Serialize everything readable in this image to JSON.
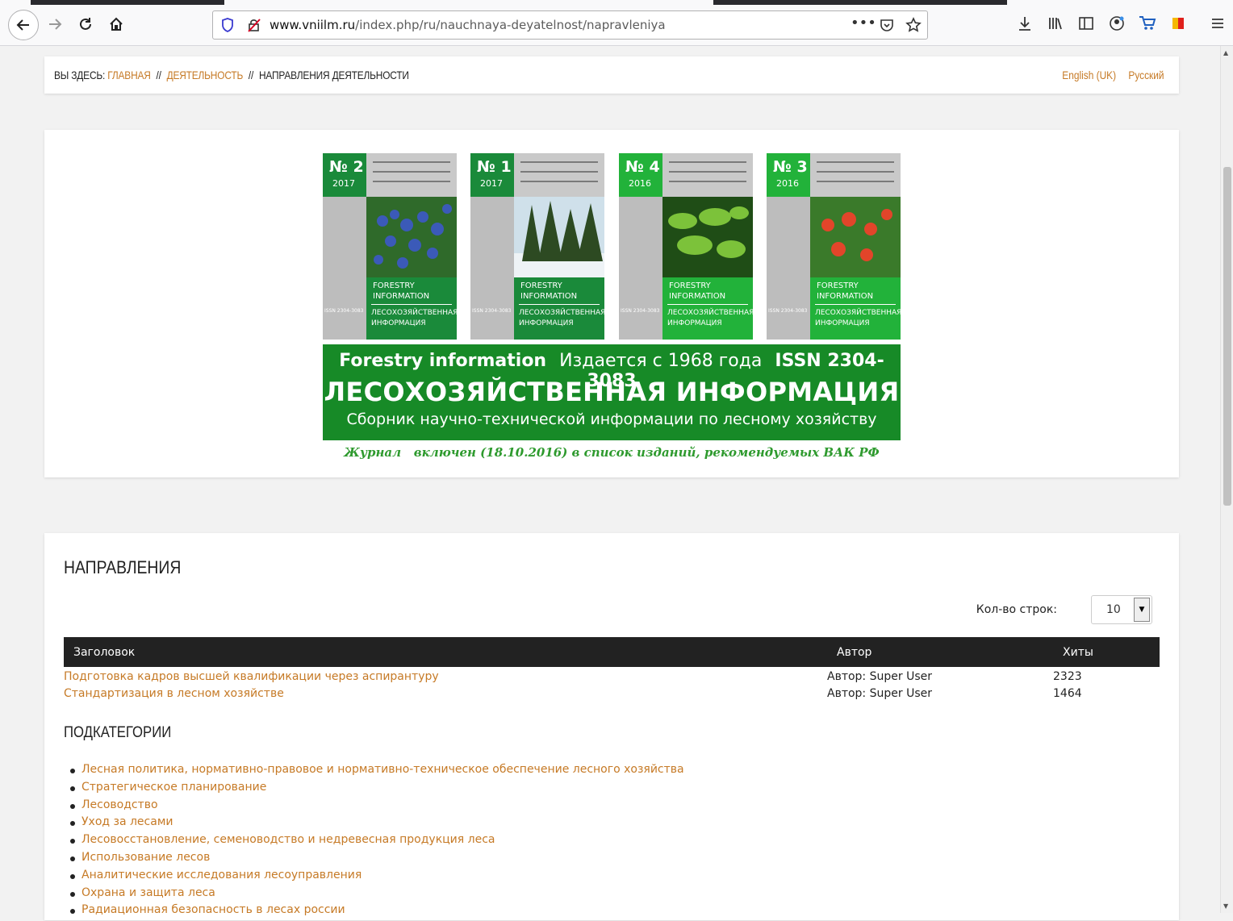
{
  "browser": {
    "url_host": "www.vniilm.ru",
    "url_path": "/index.php/ru/nauchnaya-deyatelnost/napravleniya"
  },
  "breadcrumb": {
    "prefix": "Вы здесь:",
    "items": [
      "Главная",
      "Деятельность"
    ],
    "current": "Направления деятельности"
  },
  "languages": [
    "English (UK)",
    "Русский"
  ],
  "banner": {
    "covers": [
      {
        "number": "№ 2",
        "year": "2017",
        "en": "FORESTRY INFORMATION",
        "ru": "ЛЕСОХОЗЯЙСТВЕННАЯ ИНФОРМАЦИЯ",
        "issn": "ISSN 2304-3083"
      },
      {
        "number": "№ 1",
        "year": "2017",
        "en": "FORESTRY INFORMATION",
        "ru": "ЛЕСОХОЗЯЙСТВЕННАЯ ИНФОРМАЦИЯ",
        "issn": "ISSN 2304-3083"
      },
      {
        "number": "№ 4",
        "year": "2016",
        "en": "FORESTRY INFORMATION",
        "ru": "ЛЕСОХОЗЯЙСТВЕННАЯ ИНФОРМАЦИЯ",
        "issn": "ISSN 2304-3083"
      },
      {
        "number": "№ 3",
        "year": "2016",
        "en": "FORESTRY INFORMATION",
        "ru": "ЛЕСОХОЗЯЙСТВЕННАЯ ИНФОРМАЦИЯ",
        "issn": "ISSN 2304-3083"
      }
    ],
    "journal_en": "Forestry information",
    "since": "Издается с 1968 года",
    "issn": "ISSN 2304-3083",
    "title_ru": "ЛЕСОХОЗЯЙСТВЕННАЯ ИНФОРМАЦИЯ",
    "subtitle": "Сборник научно-технической информации по лесному хозяйству",
    "vak_note": "Журнал   включен (18.10.2016) в список изданий, рекомендуемых ВАК РФ",
    "green": "#178a27"
  },
  "section": {
    "title": "Направления",
    "rows_label": "Кол-во строк:",
    "rows_value": "10",
    "columns": [
      "Заголовок",
      "Автор",
      "Хиты"
    ],
    "rows": [
      {
        "title": "Подготовка кадров высшей квалификации через аспирантуру",
        "author": "Автор: Super User",
        "hits": "2323"
      },
      {
        "title": "Стандартизация в лесном хозяйстве",
        "author": "Автор: Super User",
        "hits": "1464"
      }
    ],
    "subcategories_title": "Подкатегории",
    "subcategories": [
      "Лесная политика, нормативно-правовое и нормативно-техническое обеспечение лесного хозяйства",
      "Стратегическое планирование",
      "Лесоводство",
      "Уход за лесами",
      "Лесовосстановление, семеноводство и недревесная продукция леса",
      "Использование лесов",
      "Аналитические исследования лесоуправления",
      "Охрана и защита леса",
      "Радиационная безопасность в лесах россии"
    ]
  },
  "colors": {
    "link": "#c67a26",
    "table_header": "#222222"
  }
}
